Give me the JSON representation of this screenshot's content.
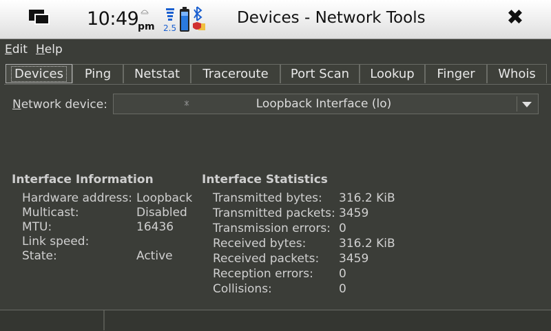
{
  "statusbar": {
    "time": "10:49",
    "ampm": "pm",
    "signal_value": "2.5"
  },
  "window": {
    "title": "Devices - Network Tools",
    "close_glyph": "✖"
  },
  "menu": {
    "edit": {
      "first": "E",
      "rest": "dit"
    },
    "help": {
      "first": "H",
      "rest": "elp"
    }
  },
  "tabs": [
    {
      "label": "Devices",
      "active": true
    },
    {
      "label": "Ping",
      "active": false
    },
    {
      "label": "Netstat",
      "active": false
    },
    {
      "label": "Traceroute",
      "active": false
    },
    {
      "label": "Port Scan",
      "active": false
    },
    {
      "label": "Lookup",
      "active": false
    },
    {
      "label": "Finger",
      "active": false
    },
    {
      "label": "Whois",
      "active": false
    }
  ],
  "device": {
    "label_first": "N",
    "label_rest": "etwork device:",
    "selected": "Loopback Interface (lo)"
  },
  "interface_info": {
    "title": "Interface Information",
    "rows": [
      {
        "label": "Hardware address:",
        "value": "Loopback"
      },
      {
        "label": "Multicast:",
        "value": "Disabled"
      },
      {
        "label": "MTU:",
        "value": "16436"
      },
      {
        "label": "Link speed:",
        "value": ""
      },
      {
        "label": "State:",
        "value": "Active"
      }
    ]
  },
  "interface_stats": {
    "title": "Interface Statistics",
    "rows": [
      {
        "label": "Transmitted bytes:",
        "value": "316.2 KiB"
      },
      {
        "label": "Transmitted packets:",
        "value": "3459"
      },
      {
        "label": "Transmission errors:",
        "value": "0"
      },
      {
        "label": "Received bytes:",
        "value": "316.2 KiB"
      },
      {
        "label": "Received packets:",
        "value": "3459"
      },
      {
        "label": "Reception errors:",
        "value": "0"
      },
      {
        "label": "Collisions:",
        "value": "0"
      }
    ]
  },
  "icons": {
    "task_switcher": "window-switcher-icon",
    "alarm": "alarm-icon",
    "signal": "signal-icon",
    "battery": "battery-icon",
    "bluetooth": "bluetooth-icon",
    "presence": "presence-icon",
    "close": "close-icon",
    "dropdown": "chevron-down-icon"
  },
  "colors": {
    "background": "#3b3d38",
    "titlebar": "#ececec",
    "text": "#d0d0d0",
    "accent_blue": "#1a5fd0"
  }
}
